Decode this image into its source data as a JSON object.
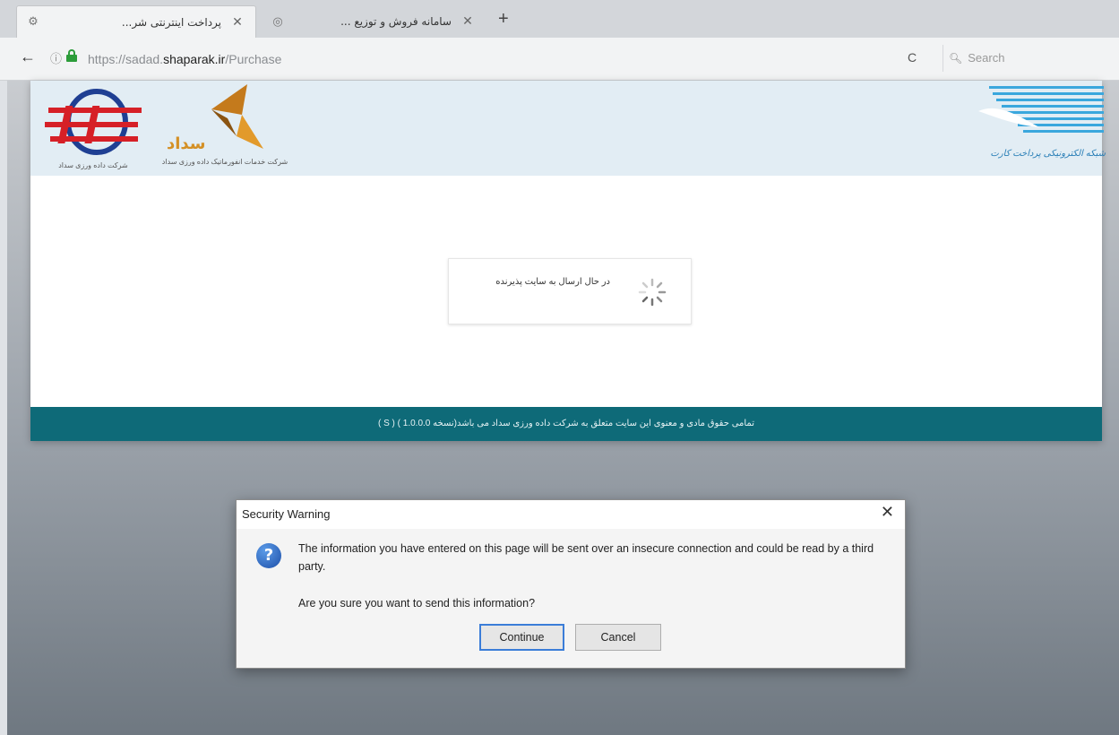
{
  "browser": {
    "tabs": [
      {
        "title": "پرداخت اینترنتی شر...",
        "active": true
      },
      {
        "title": "سامانه فروش و توزیع ...",
        "active": false
      }
    ],
    "new_tab_symbol": "+",
    "url": {
      "scheme": "https://",
      "host_prefix": "sadad.",
      "host_main": "shaparak.ir",
      "path": "/Purchase"
    },
    "search_placeholder": "Search",
    "icons": {
      "back": "back-arrow-icon",
      "info": "info-icon",
      "lock": "lock-icon",
      "reload": "reload-icon",
      "search": "magnifier-icon"
    }
  },
  "site": {
    "logo_left_caption": "شرکت داده ورزی سداد",
    "logo_sadad_brand": "سداد",
    "logo_sadad_caption": "شرکت خدمات انفورماتیک داده ورزی سداد",
    "logo_shaparak_caption": "شبکه الکترونیکی پرداخت کارت",
    "loading_text": "در حال ارسال به سایت پذیرنده",
    "footer_text": "تمامی حقوق مادی و معنوی این سایت متعلق به شرکت داده ورزی سداد می باشد(نسخه 1.0.0.0 ) ( S )",
    "colors": {
      "header_bg": "#e2edf4",
      "footer_bg": "#0e6a78"
    }
  },
  "dialog": {
    "title": "Security Warning",
    "close_symbol": "✕",
    "icon": "question-icon",
    "message": "The information you have entered on this page will be sent over an insecure connection and could be read by a third party.",
    "question": "Are you sure you want to send this information?",
    "continue_label": "Continue",
    "cancel_label": "Cancel"
  }
}
